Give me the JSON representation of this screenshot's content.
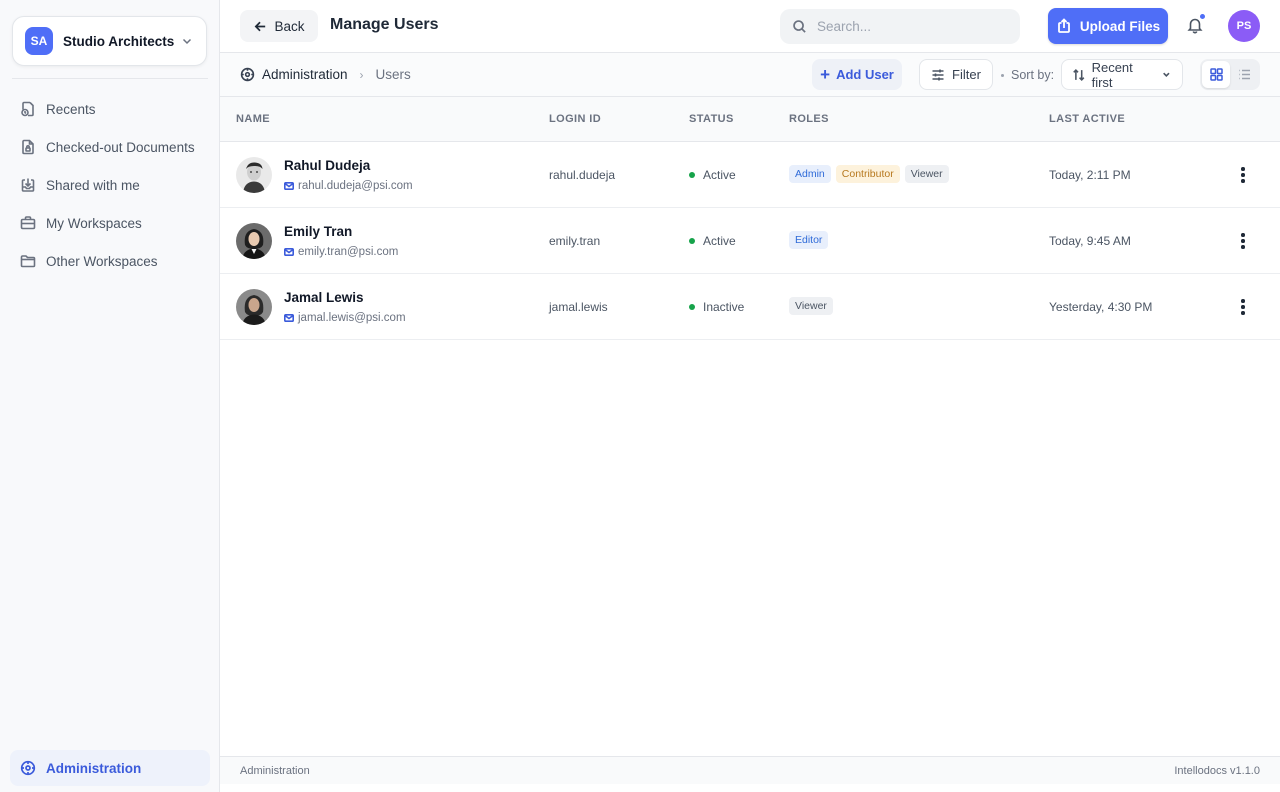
{
  "workspace": {
    "initials": "SA",
    "name": "Studio Architects"
  },
  "sidebar": {
    "items": [
      {
        "label": "Recents",
        "icon": "recents-icon"
      },
      {
        "label": "Checked-out Documents",
        "icon": "document-lock-icon"
      },
      {
        "label": "Shared with me",
        "icon": "inbox-icon"
      },
      {
        "label": "My Workspaces",
        "icon": "briefcase-icon"
      },
      {
        "label": "Other Workspaces",
        "icon": "folder-icon"
      }
    ],
    "admin_label": "Administration"
  },
  "header": {
    "back_label": "Back",
    "title": "Manage Users",
    "search_placeholder": "Search...",
    "upload_label": "Upload Files",
    "user_initials": "PS"
  },
  "toolbar": {
    "breadcrumb": [
      "Administration",
      "Users"
    ],
    "add_user_label": "Add User",
    "filter_label": "Filter",
    "sort_label": "Sort by:",
    "sort_value": "Recent first"
  },
  "table": {
    "columns": [
      "NAME",
      "LOGIN ID",
      "STATUS",
      "ROLES",
      "LAST ACTIVE"
    ],
    "rows": [
      {
        "name": "Rahul Dudeja",
        "email": "rahul.dudeja@psi.com",
        "login": "rahul.dudeja",
        "status": "Active",
        "roles": [
          "Admin",
          "Contributor",
          "Viewer"
        ],
        "last_active": "Today, 2:11 PM"
      },
      {
        "name": "Emily Tran",
        "email": "emily.tran@psi.com",
        "login": "emily.tran",
        "status": "Active",
        "roles": [
          "Editor"
        ],
        "last_active": "Today, 9:45 AM"
      },
      {
        "name": "Jamal Lewis",
        "email": "jamal.lewis@psi.com",
        "login": "jamal.lewis",
        "status": "Inactive",
        "roles": [
          "Viewer"
        ],
        "last_active": "Yesterday, 4:30 PM"
      }
    ]
  },
  "footer": {
    "left": "Administration",
    "right": "Intellodocs v1.1.0"
  },
  "colors": {
    "accent": "#4f6ef7",
    "active_status": "#16a34a",
    "avatar": "#8b5cf6"
  }
}
